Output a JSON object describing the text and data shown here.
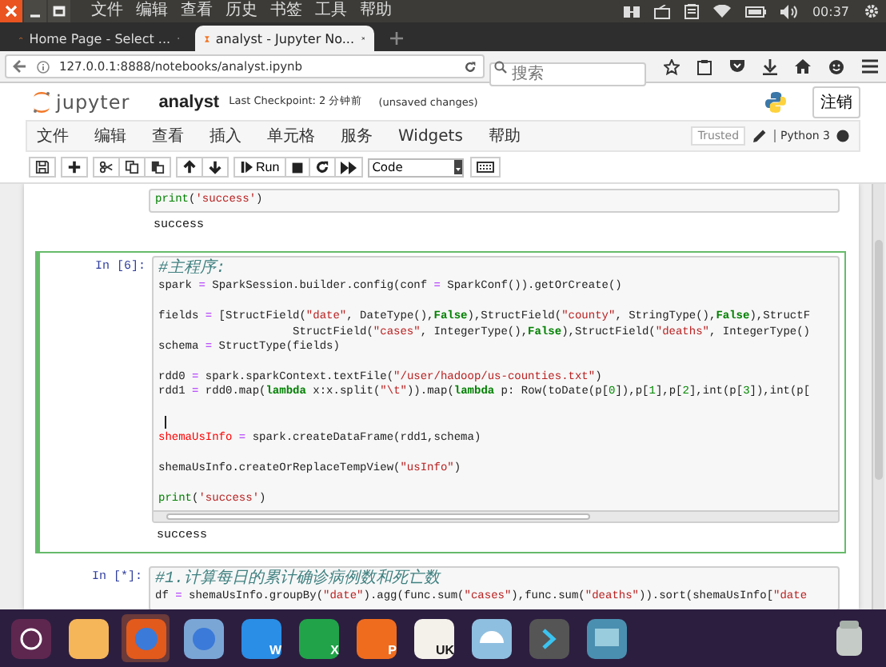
{
  "os_bar": {
    "menus": [
      "文件",
      "编辑",
      "查看",
      "历史",
      "书签",
      "工具",
      "帮助"
    ],
    "clock": "00:37"
  },
  "browser": {
    "tabs": [
      {
        "title": "Home Page - Select ...",
        "selected": false
      },
      {
        "title": "analyst - Jupyter No...",
        "selected": true
      }
    ],
    "url": "127.0.0.1:8888/notebooks/analyst.ipynb",
    "search": {
      "placeholder": "搜索"
    }
  },
  "jupyter": {
    "logo": "jupyter",
    "notebook_name": "analyst",
    "checkpoint": "Last Checkpoint: 2 分钟前",
    "autosave": "(unsaved changes)",
    "logout": "注销",
    "menu": [
      "文件",
      "编辑",
      "查看",
      "插入",
      "单元格",
      "服务",
      "Widgets",
      "帮助"
    ],
    "trusted": "Trusted",
    "kernel": "Python 3",
    "kernel_busy": true,
    "toolbar": [
      {
        "kind": "buttons",
        "buttons": [
          {
            "kind": "save"
          }
        ]
      },
      {
        "kind": "buttons",
        "buttons": [
          {
            "kind": "insert"
          }
        ]
      },
      {
        "kind": "buttons",
        "buttons": [
          {
            "kind": "cut"
          },
          {
            "kind": "copy"
          },
          {
            "kind": "paste"
          }
        ]
      },
      {
        "kind": "buttons",
        "buttons": [
          {
            "kind": "move-up"
          },
          {
            "kind": "move-down"
          }
        ]
      },
      {
        "kind": "buttons",
        "buttons": [
          {
            "kind": "run",
            "label": "Run"
          },
          {
            "kind": "interrupt"
          },
          {
            "kind": "restart"
          },
          {
            "kind": "restart-run-all"
          }
        ]
      },
      {
        "kind": "select",
        "value": "Code"
      },
      {
        "kind": "buttons",
        "buttons": [
          {
            "kind": "command-palette"
          }
        ]
      }
    ]
  },
  "cells": [
    {
      "selected": false,
      "lines": [
        {
          "kind": "code",
          "tokens": [
            {
              "kind": "builtin",
              "text": "print"
            },
            {
              "kind": "plain",
              "text": "("
            },
            {
              "kind": "string",
              "text": "'success'"
            },
            {
              "kind": "plain",
              "text": ")"
            }
          ]
        }
      ],
      "output": "success"
    },
    {
      "selected": true,
      "prompt": "In [6]:",
      "hscroll": true,
      "lines": [
        {
          "kind": "code",
          "tokens": [
            {
              "kind": "comment",
              "text": "#主程序:"
            }
          ]
        },
        {
          "kind": "code",
          "tokens": [
            {
              "kind": "plain",
              "text": "spark "
            },
            {
              "kind": "operator",
              "text": "="
            },
            {
              "kind": "plain",
              "text": " SparkSession.builder.config(conf "
            },
            {
              "kind": "operator",
              "text": "="
            },
            {
              "kind": "plain",
              "text": " SparkConf()).getOrCreate()"
            }
          ]
        },
        {
          "kind": "blank"
        },
        {
          "kind": "code",
          "tokens": [
            {
              "kind": "plain",
              "text": "fields "
            },
            {
              "kind": "operator",
              "text": "="
            },
            {
              "kind": "plain",
              "text": " [StructField("
            },
            {
              "kind": "string",
              "text": "\"date\""
            },
            {
              "kind": "plain",
              "text": ", DateType(),"
            },
            {
              "kind": "keyword",
              "text": "False"
            },
            {
              "kind": "plain",
              "text": "),StructField("
            },
            {
              "kind": "string",
              "text": "\"county\""
            },
            {
              "kind": "plain",
              "text": ", StringType(),"
            },
            {
              "kind": "keyword",
              "text": "False"
            },
            {
              "kind": "plain",
              "text": "),StructF"
            }
          ]
        },
        {
          "kind": "code",
          "tokens": [
            {
              "kind": "plain",
              "text": "                    StructField("
            },
            {
              "kind": "string",
              "text": "\"cases\""
            },
            {
              "kind": "plain",
              "text": ", IntegerType(),"
            },
            {
              "kind": "keyword",
              "text": "False"
            },
            {
              "kind": "plain",
              "text": "),StructField("
            },
            {
              "kind": "string",
              "text": "\"deaths\""
            },
            {
              "kind": "plain",
              "text": ", IntegerType()"
            }
          ]
        },
        {
          "kind": "code",
          "tokens": [
            {
              "kind": "plain",
              "text": "schema "
            },
            {
              "kind": "operator",
              "text": "="
            },
            {
              "kind": "plain",
              "text": " StructType(fields)"
            }
          ]
        },
        {
          "kind": "blank"
        },
        {
          "kind": "code",
          "tokens": [
            {
              "kind": "plain",
              "text": "rdd0 "
            },
            {
              "kind": "operator",
              "text": "="
            },
            {
              "kind": "plain",
              "text": " spark.sparkContext.textFile("
            },
            {
              "kind": "string",
              "text": "\"/user/hadoop/us-counties.txt\""
            },
            {
              "kind": "plain",
              "text": ")"
            }
          ]
        },
        {
          "kind": "code",
          "tokens": [
            {
              "kind": "plain",
              "text": "rdd1 "
            },
            {
              "kind": "operator",
              "text": "="
            },
            {
              "kind": "plain",
              "text": " rdd0.map("
            },
            {
              "kind": "keyword",
              "text": "lambda"
            },
            {
              "kind": "plain",
              "text": " x:x.split("
            },
            {
              "kind": "string",
              "text": "\"\\t\""
            },
            {
              "kind": "plain",
              "text": ")).map("
            },
            {
              "kind": "keyword",
              "text": "lambda"
            },
            {
              "kind": "plain",
              "text": " p: Row(toDate(p["
            },
            {
              "kind": "number",
              "text": "0"
            },
            {
              "kind": "plain",
              "text": "]),p["
            },
            {
              "kind": "number",
              "text": "1"
            },
            {
              "kind": "plain",
              "text": "],p["
            },
            {
              "kind": "number",
              "text": "2"
            },
            {
              "kind": "plain",
              "text": "],int(p["
            },
            {
              "kind": "number",
              "text": "3"
            },
            {
              "kind": "plain",
              "text": "]),int(p["
            }
          ]
        },
        {
          "kind": "blank"
        },
        {
          "kind": "cursor"
        },
        {
          "kind": "code",
          "tokens": [
            {
              "kind": "highlight",
              "text": "shemaUsInfo"
            },
            {
              "kind": "operator",
              "text": " ="
            },
            {
              "kind": "plain",
              "text": " spark.createDataFrame(rdd1,schema)"
            }
          ]
        },
        {
          "kind": "blank"
        },
        {
          "kind": "code",
          "tokens": [
            {
              "kind": "plain",
              "text": "shemaUsInfo.createOrReplaceTempView("
            },
            {
              "kind": "string",
              "text": "\"usInfo\""
            },
            {
              "kind": "plain",
              "text": ")"
            }
          ]
        },
        {
          "kind": "blank"
        },
        {
          "kind": "code",
          "tokens": [
            {
              "kind": "builtin",
              "text": "print"
            },
            {
              "kind": "plain",
              "text": "("
            },
            {
              "kind": "string",
              "text": "'success'"
            },
            {
              "kind": "plain",
              "text": ")"
            }
          ]
        }
      ],
      "output": "success"
    },
    {
      "selected": false,
      "prompt": "In [*]:",
      "lines": [
        {
          "kind": "code",
          "tokens": [
            {
              "kind": "comment",
              "text": "#1.计算每日的累计确诊病例数和死亡数"
            }
          ]
        },
        {
          "kind": "code",
          "tokens": [
            {
              "kind": "plain",
              "text": "df "
            },
            {
              "kind": "operator",
              "text": "="
            },
            {
              "kind": "plain",
              "text": " shemaUsInfo.groupBy("
            },
            {
              "kind": "string",
              "text": "\"date\""
            },
            {
              "kind": "plain",
              "text": ").agg(func.sum("
            },
            {
              "kind": "string",
              "text": "\"cases\""
            },
            {
              "kind": "plain",
              "text": "),func.sum("
            },
            {
              "kind": "string",
              "text": "\"deaths\""
            },
            {
              "kind": "plain",
              "text": ")).sort(shemaUsInfo["
            },
            {
              "kind": "string",
              "text": "\"date"
            }
          ]
        }
      ]
    }
  ],
  "dock": [
    {
      "kind": "launcher",
      "selected": false
    },
    {
      "kind": "files",
      "selected": false
    },
    {
      "kind": "firefox",
      "selected": true
    },
    {
      "kind": "chromium",
      "selected": false
    },
    {
      "kind": "writer",
      "label": "W",
      "selected": false
    },
    {
      "kind": "sheets",
      "label": "X",
      "selected": false
    },
    {
      "kind": "slides",
      "label": "P",
      "selected": false
    },
    {
      "kind": "software",
      "label": "UK",
      "selected": false
    },
    {
      "kind": "app",
      "selected": false
    },
    {
      "kind": "terminal",
      "selected": false
    },
    {
      "kind": "screenshot",
      "selected": false
    }
  ]
}
